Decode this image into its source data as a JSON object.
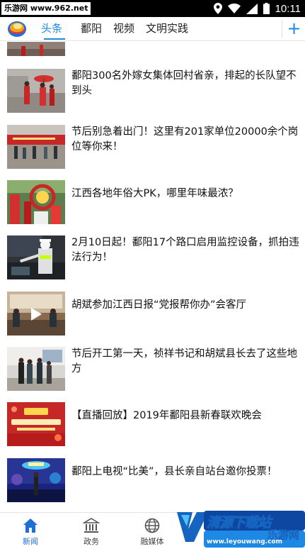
{
  "status_bar": {
    "watermark": "乐游网 www.962.net",
    "time": "10:11"
  },
  "tabs": [
    {
      "label": "头条",
      "active": true
    },
    {
      "label": "鄱阳",
      "active": false
    },
    {
      "label": "视频",
      "active": false
    },
    {
      "label": "文明实践",
      "active": false
    }
  ],
  "add_tab_label": "+",
  "news": [
    {
      "title": "鄱阳300名外嫁女集体回村省亲，排起的长队望不到头",
      "thumb_icon": "wedding-procession-photo"
    },
    {
      "title": "节后别急着出门！这里有201家单位20000余个岗位等你来！",
      "thumb_icon": "job-fair-photo"
    },
    {
      "title": "江西各地年俗大PK，哪里年味最浓？",
      "thumb_icon": "festival-photo"
    },
    {
      "title": "2月10日起！鄱阳17个路口启用监控设备，抓拍违法行为！",
      "thumb_icon": "traffic-police-photo"
    },
    {
      "title": "胡斌参加江西日报“党报帮你办”会客厅",
      "thumb_icon": "video-meeting-photo",
      "has_video": true
    },
    {
      "title": "节后开工第一天，祯祥书记和胡斌县长去了这些地方",
      "thumb_icon": "inspection-photo"
    },
    {
      "title": "【直播回放】2019年鄱阳县新春联欢晚会",
      "thumb_icon": "gala-banner-photo"
    },
    {
      "title": "鄱阳上电视“比美”，县长亲自站台邀你投票！",
      "thumb_icon": "tv-stage-photo"
    }
  ],
  "bottom_nav": [
    {
      "label": "新闻",
      "icon": "home-icon",
      "active": true
    },
    {
      "label": "政务",
      "icon": "government-icon",
      "active": false
    },
    {
      "label": "融媒体",
      "icon": "globe-icon",
      "active": false
    }
  ],
  "site_badge": {
    "text": "清源下载站",
    "suffix": "乐游网",
    "url": "www.leyouwang.com"
  },
  "colors": {
    "accent": "#1e88e5",
    "status_bar": "#000000"
  }
}
